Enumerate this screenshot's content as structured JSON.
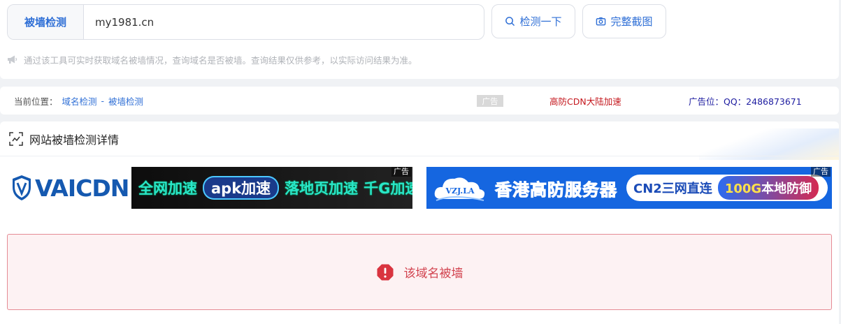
{
  "search": {
    "prefix_label": "被墙检测",
    "value": "my1981.cn",
    "check_button": "检测一下",
    "screenshot_button": "完整截图"
  },
  "notice": {
    "text": "通过该工具可实时获取域名被墙情况，查询域名是否被墙。查询结果仅供参考，以实际访问结果为准。"
  },
  "breadcrumb": {
    "prefix": "当前位置：",
    "link1": "域名检测",
    "separator": "-",
    "link2": "被墙检测"
  },
  "ads": {
    "tag_label": "广告",
    "red_link": "高防CDN大陆加速",
    "blue_link": "广告位：QQ：2486873671",
    "banner_left": {
      "brand": "VAICDN",
      "seg1": "全网加速",
      "seg2": "apk加速",
      "seg3": "落地页加速",
      "seg4": "千G加速"
    },
    "banner_right": {
      "brand": "VZJ.LA",
      "title": "香港高防服务器",
      "pill_a": "CN2三网直连",
      "pill_b_hl": "100G",
      "pill_b": "本地防御"
    }
  },
  "section": {
    "title": "网站被墙检测详情"
  },
  "result": {
    "text": "该域名被墙"
  },
  "colors": {
    "primary": "#2f6fd6",
    "danger": "#d2434f",
    "danger_bg": "#fdf2f3",
    "page_bg": "#f0f2f5"
  }
}
